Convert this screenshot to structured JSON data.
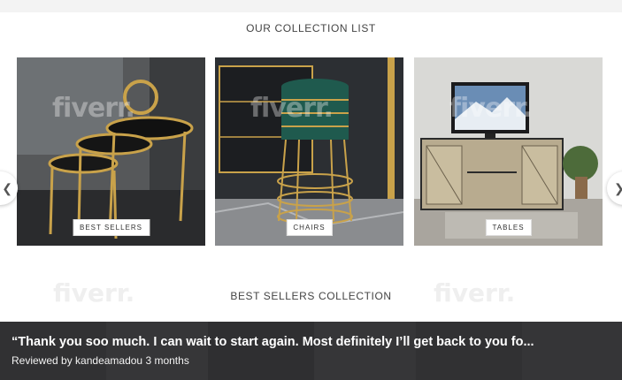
{
  "sections": {
    "collection_title": "OUR COLLECTION LIST",
    "bestsellers_title": "BEST SELLERS COLLECTION"
  },
  "collections": [
    {
      "label": "BEST SELLERS"
    },
    {
      "label": "CHAIRS"
    },
    {
      "label": "TABLES"
    }
  ],
  "watermark": "fiverr.",
  "carousel": {
    "prev_icon": "chevron-left-icon",
    "next_icon": "chevron-right-icon"
  },
  "review": {
    "quote": "“Thank you soo much. I can wait to start again. Most definitely I’ll get back to you fo...",
    "reviewer_prefix": "Reviewed by",
    "reviewer": "kandeamadou",
    "time": "3 months"
  },
  "colors": {
    "gold": "#c9a24a",
    "teal": "#1f5a4e",
    "overlay": "#28282a"
  }
}
